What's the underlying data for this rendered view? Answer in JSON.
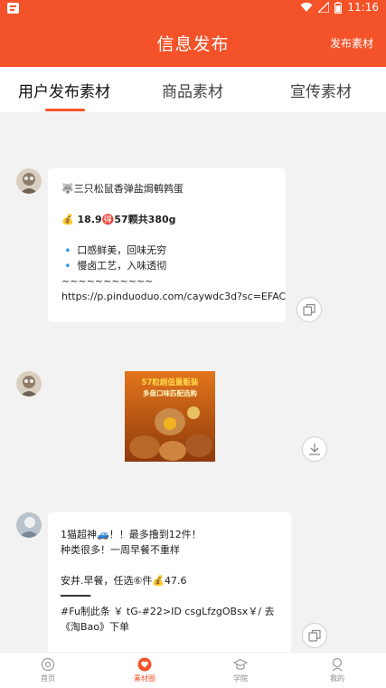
{
  "status_bar": {
    "time": "11:16"
  },
  "header": {
    "title": "信息发布",
    "action_label": "发布素材"
  },
  "tabs": [
    {
      "label": "用户发布素材"
    },
    {
      "label": "商品素材"
    },
    {
      "label": "宣传素材"
    }
  ],
  "active_tab_index": 0,
  "posts": [
    {
      "avatar_icon": "avatar-image",
      "lines": [
        "🐺三只松鼠香弹盐焗鹌鹑蛋",
        "",
        "💰 18.9🉐57颗共380g",
        "",
        "🔹 口感鲜美，回味无穷",
        "🔹 慢卤工艺，入味透彻",
        "~~~~~~~~~~~",
        "https://p.pinduoduo.com/caywdc3d?sc=EFAC"
      ],
      "action_icon": "copy-icon"
    },
    {
      "avatar_icon": "avatar-image",
      "image_text": {
        "line1": "57粒超值量贩装",
        "line2": "多盘口味匹配选购"
      },
      "action_icon": "download-icon"
    },
    {
      "avatar_icon": "avatar-image",
      "lines": [
        "1猫超神🚙！！最多撸到12件！",
        "种类很多！一周早餐不重样",
        "",
        "安井.早餐，任选⑥件💰47.6",
        "━━━━━",
        "#Fu制此条 ￥ tG-#22>ID csgLfzgOBsx￥/ 去",
        "《淘Bao》下单"
      ],
      "action_icon": "copy-icon"
    }
  ],
  "bottom_nav": [
    {
      "label": "首页",
      "icon": "home-icon"
    },
    {
      "label": "素材圈",
      "icon": "material-circle-icon"
    },
    {
      "label": "学院",
      "icon": "academy-icon"
    },
    {
      "label": "我的",
      "icon": "profile-icon"
    }
  ],
  "colors": {
    "accent": "#f4532a",
    "background": "#f2f2f2"
  }
}
